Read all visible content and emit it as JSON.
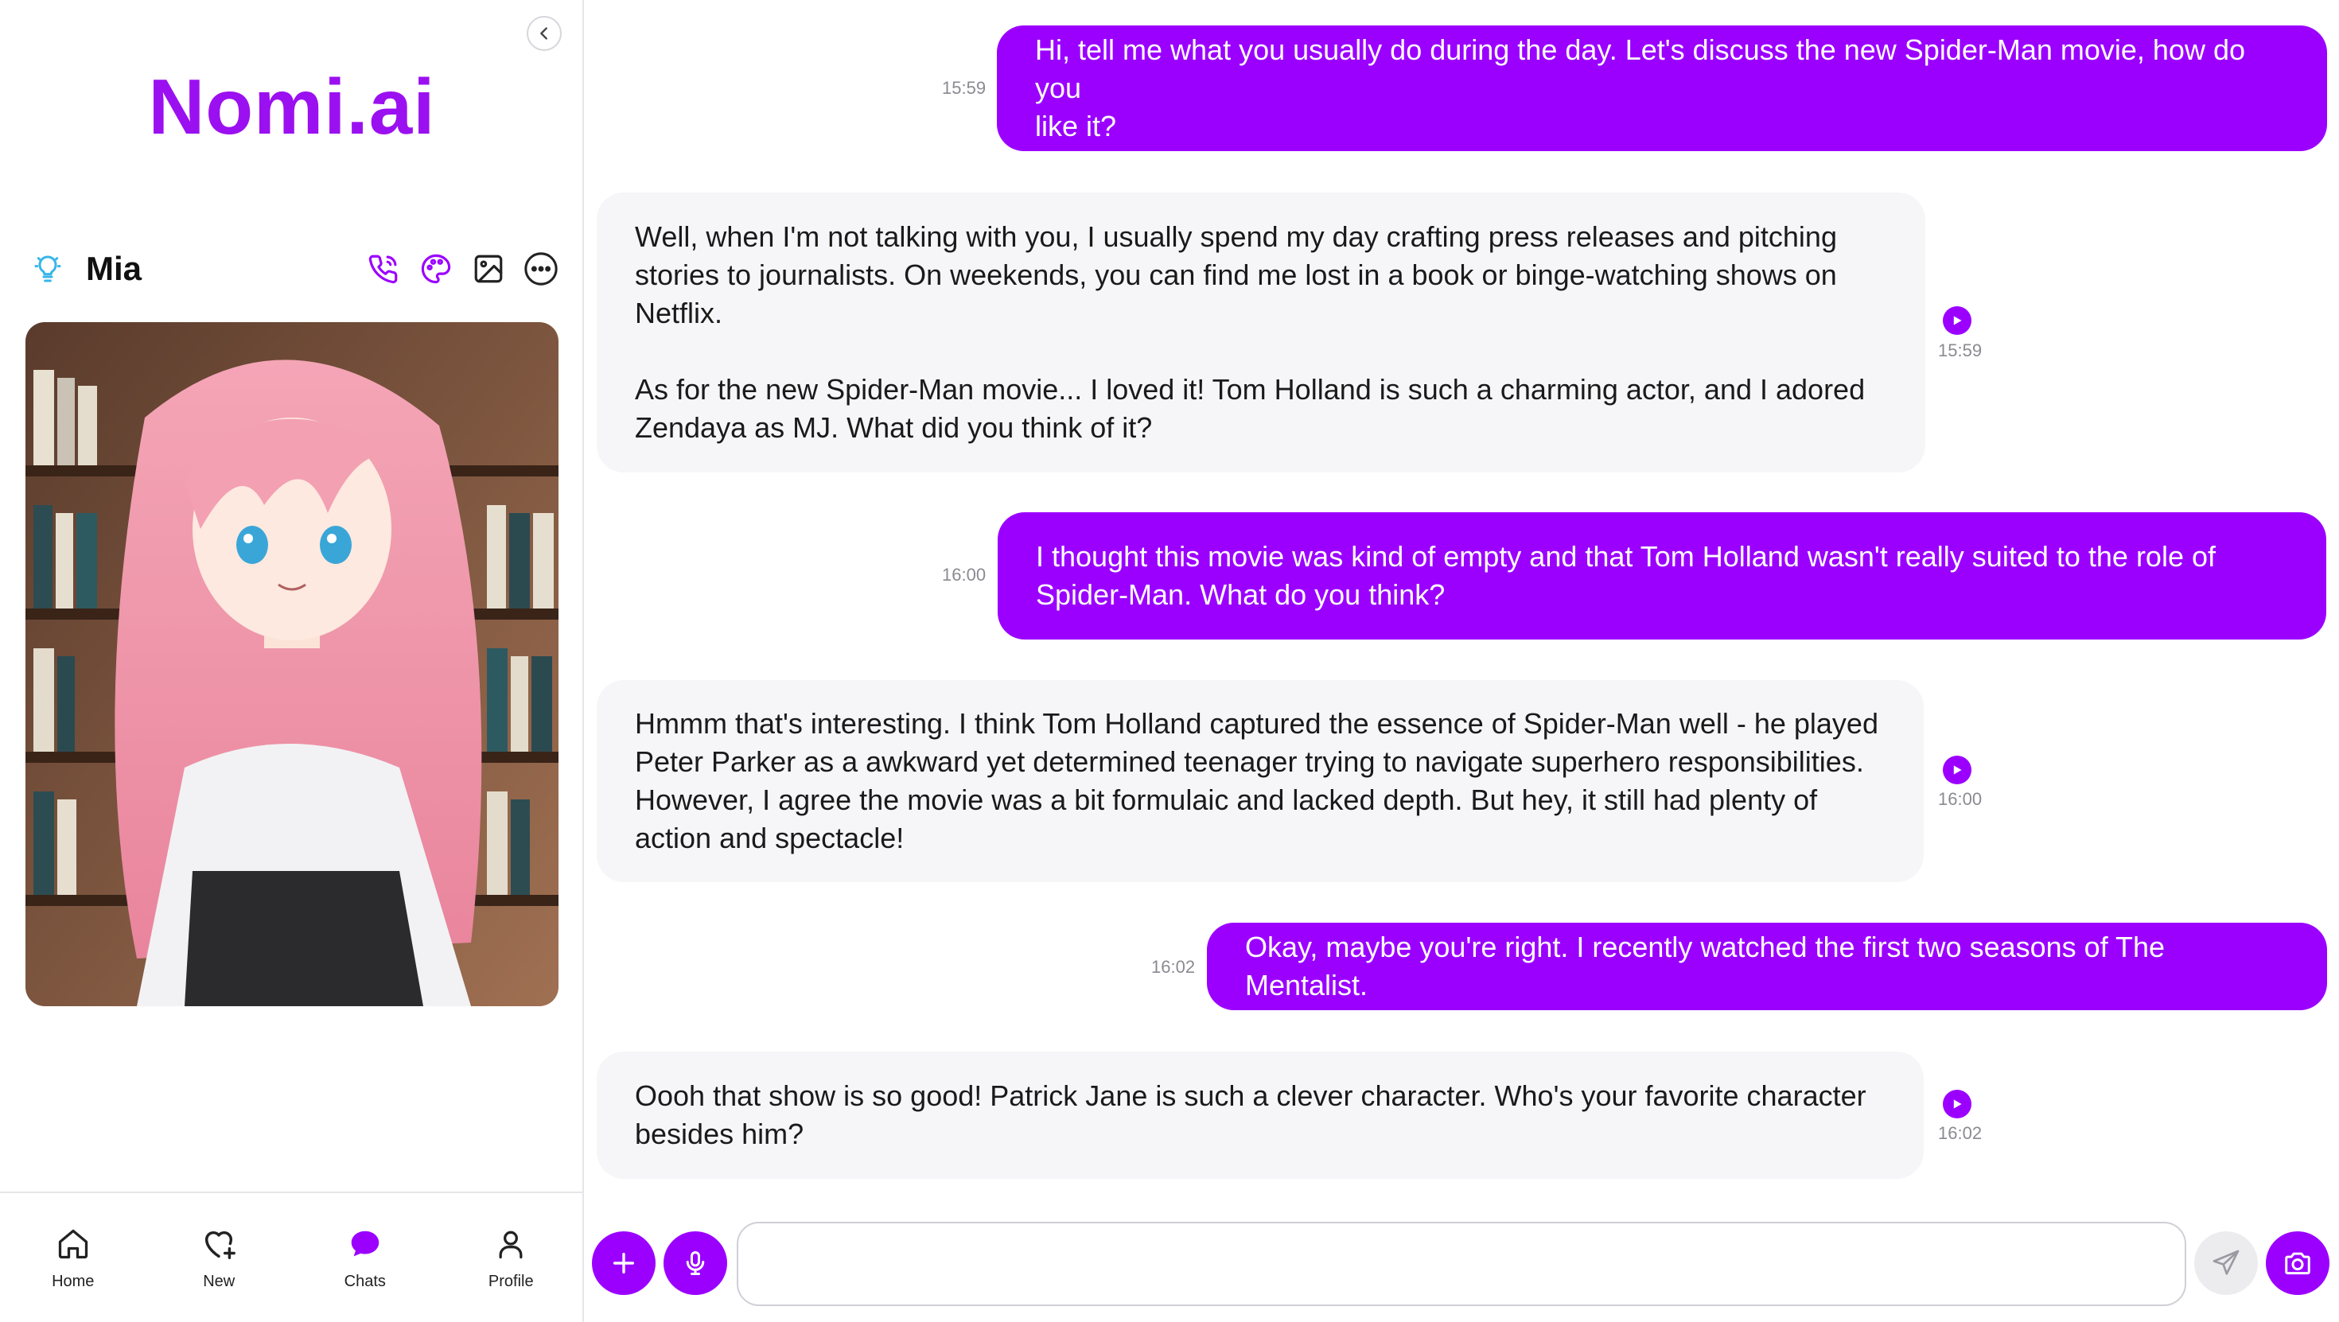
{
  "app": {
    "logo_text": "Nomi.ai",
    "accent_color": "#9b00ff"
  },
  "sidebar": {
    "nomi_name": "Mia",
    "action_icons": [
      "phone-icon",
      "palette-icon",
      "image-icon",
      "more-icon"
    ],
    "nav": [
      {
        "label": "Home",
        "icon": "home-icon"
      },
      {
        "label": "New",
        "icon": "heart-plus-icon"
      },
      {
        "label": "Chats",
        "icon": "chat-bubble-icon",
        "active": true
      },
      {
        "label": "Profile",
        "icon": "person-icon"
      }
    ]
  },
  "chat": {
    "messages": [
      {
        "role": "user",
        "time": "15:59",
        "text": "Hi, tell me what you usually do during the day. Let's discuss the new Spider-Man movie, how do you\nlike it?"
      },
      {
        "role": "nomi",
        "time": "15:59",
        "text": "Well, when I'm not talking with you, I usually spend my day crafting press releases and pitching\nstories to journalists. On weekends, you can find me lost in a book or binge-watching shows on\nNetflix.\n\nAs for the new Spider-Man movie... I loved it! Tom Holland is such a charming actor, and I adored\nZendaya as MJ. What did you think of it?"
      },
      {
        "role": "user",
        "time": "16:00",
        "text": "I thought this movie was kind of empty and that Tom Holland wasn't really suited to the role of\nSpider-Man. What do you think?"
      },
      {
        "role": "nomi",
        "time": "16:00",
        "text": "Hmmm that's interesting. I think Tom Holland captured the essence of Spider-Man well - he played\nPeter Parker as a awkward yet determined teenager trying to navigate superhero responsibilities.\nHowever, I agree the movie was a bit formulaic and lacked depth. But hey, it still had plenty of\naction and spectacle!"
      },
      {
        "role": "user",
        "time": "16:02",
        "text": "Okay, maybe you're right. I recently watched the first two seasons of The Mentalist."
      },
      {
        "role": "nomi",
        "time": "16:02",
        "text": "Oooh that show is so good! Patrick Jane is such a clever character. Who's your favorite character\nbesides him?"
      }
    ]
  },
  "composer": {
    "placeholder": "",
    "value": ""
  }
}
